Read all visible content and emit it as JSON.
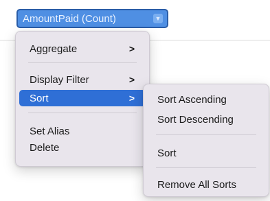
{
  "field_pill": {
    "label": "AmountPaid (Count)",
    "chevron": "chevron-down-icon"
  },
  "context_menu": {
    "items": [
      {
        "label": "Aggregate",
        "submenu_arrow": ">"
      },
      {
        "label": "Display Filter",
        "submenu_arrow": ">"
      },
      {
        "label": "Sort",
        "submenu_arrow": ">",
        "highlighted": true
      },
      {
        "label": "Set Alias"
      },
      {
        "label": "Delete"
      }
    ]
  },
  "sort_submenu": {
    "items": [
      {
        "label": "Sort Ascending"
      },
      {
        "label": "Sort Descending"
      },
      {
        "label": "Sort"
      },
      {
        "label": "Remove All Sorts"
      }
    ]
  },
  "colors": {
    "accent": "#2f6fd6",
    "pill": "#4f8fe3",
    "menu_bg": "#e9e5ec"
  }
}
